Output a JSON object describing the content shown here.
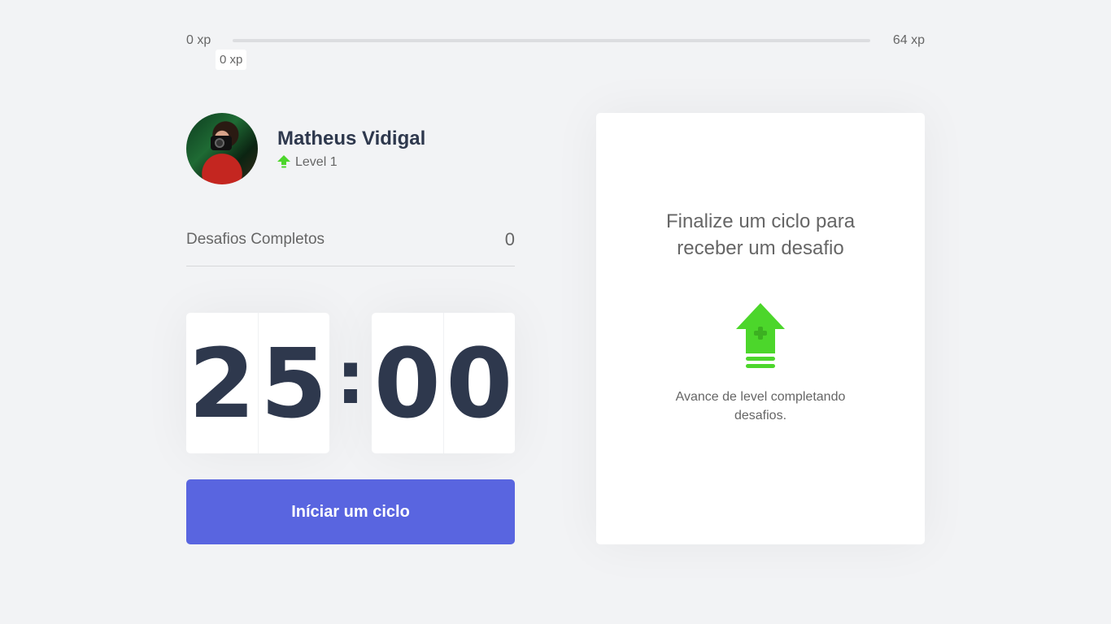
{
  "xp_bar": {
    "min_label": "0 xp",
    "max_label": "64 xp",
    "current_label": "0 xp",
    "progress": 0
  },
  "profile": {
    "name": "Matheus Vidigal",
    "level_label": "Level 1",
    "level_icon": "level-up-arrow-icon"
  },
  "completed_challenges": {
    "label": "Desafios Completos",
    "count": "0"
  },
  "countdown": {
    "minute_left": "2",
    "minute_right": "5",
    "separator": ":",
    "second_left": "0",
    "second_right": "0"
  },
  "start_button": {
    "label": "Iníciar um ciclo"
  },
  "challenge_box": {
    "title": "Finalize um ciclo para receber um desafio",
    "hint": "Avance de level completando desafios.",
    "icon": "level-up-icon"
  },
  "colors": {
    "background": "#F2F3F5",
    "accent": "#5965E0",
    "green": "#4CD62B",
    "title": "#2E384D",
    "text": "#666666"
  }
}
